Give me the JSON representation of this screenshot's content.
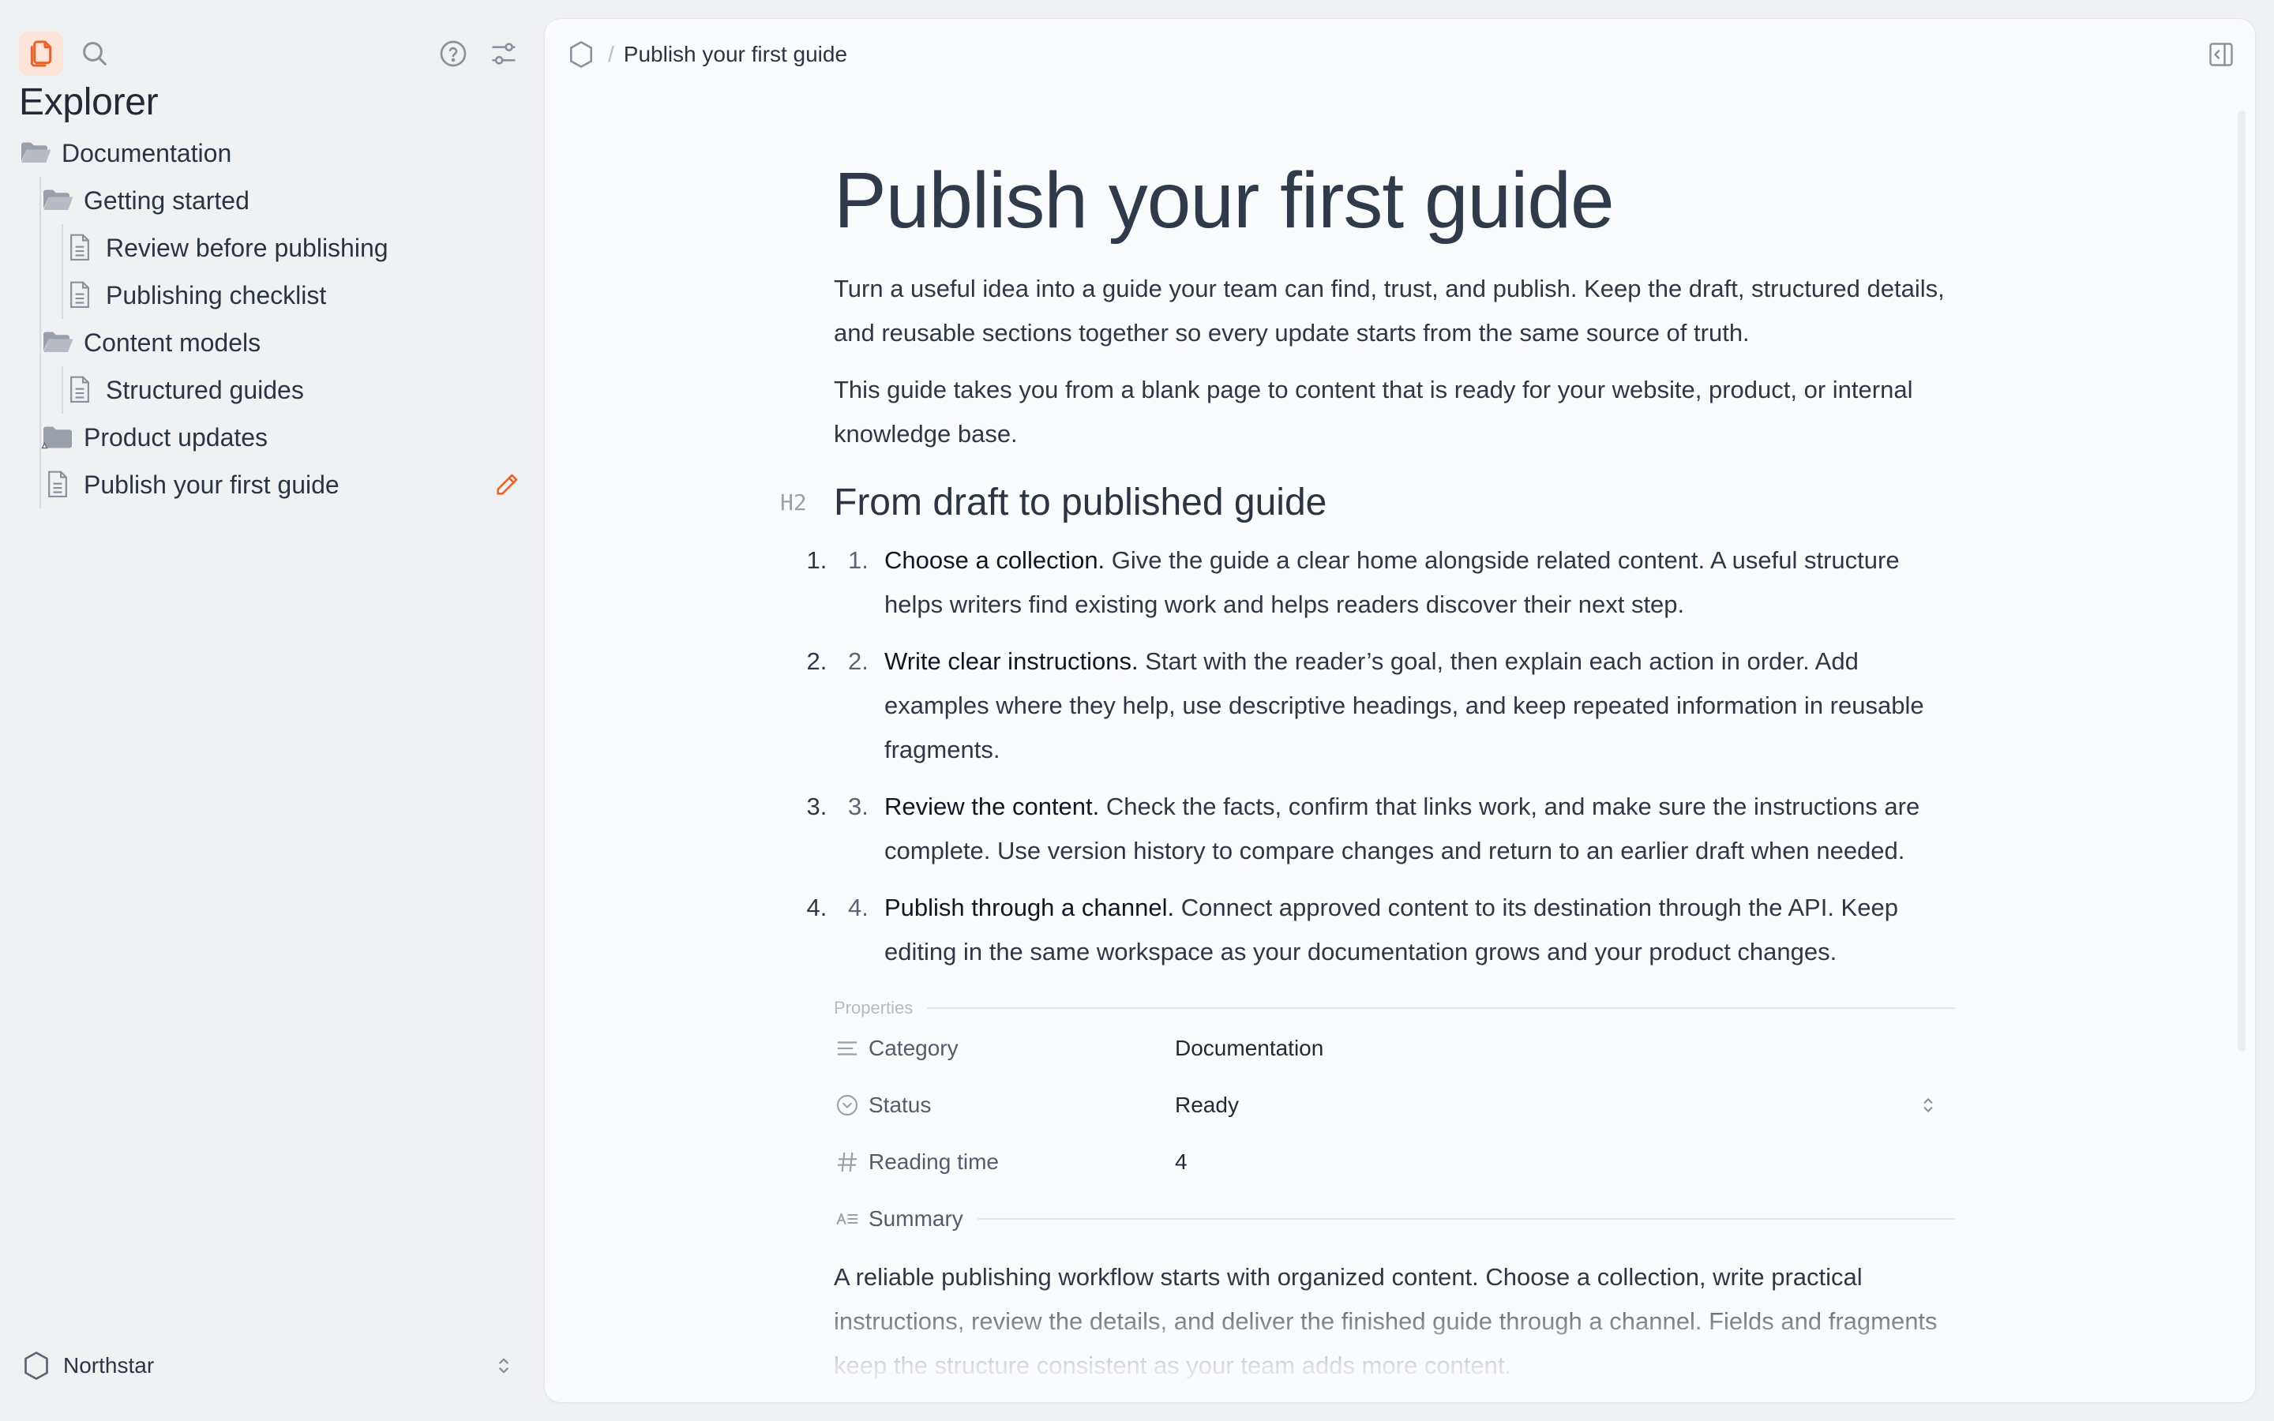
{
  "sidebar": {
    "title": "Explorer",
    "tree": [
      {
        "label": "Documentation",
        "type": "folder-open",
        "depth": 0
      },
      {
        "label": "Getting started",
        "type": "folder-open",
        "depth": 1
      },
      {
        "label": "Review before publishing",
        "type": "file",
        "depth": 2
      },
      {
        "label": "Publishing checklist",
        "type": "file",
        "depth": 2
      },
      {
        "label": "Content models",
        "type": "folder-open",
        "depth": 1
      },
      {
        "label": "Structured guides",
        "type": "file",
        "depth": 2
      },
      {
        "label": "Product updates",
        "type": "folder-closed",
        "depth": 1
      },
      {
        "label": "Publish your first guide",
        "type": "file",
        "depth": 1,
        "active": true
      }
    ],
    "workspace": "Northstar"
  },
  "topbar": {
    "breadcrumb": "Publish your first guide",
    "separator": "/"
  },
  "doc": {
    "title": "Publish your first guide",
    "intro": [
      "Turn a useful idea into a guide your team can find, trust, and publish. Keep the draft, structured details, and reusable sections together so every update starts from the same source of truth.",
      "This guide takes you from a blank page to content that is ready for your website, product, or internal knowledge base."
    ],
    "h2_marker": "H2",
    "h2": "From draft to published guide",
    "steps": [
      {
        "num": "1.",
        "lead": "Choose a collection.",
        "text": " Give the guide a clear home alongside related content. A useful structure helps writers find existing work and helps readers discover their next step."
      },
      {
        "num": "2.",
        "lead": "Write clear instructions.",
        "text": " Start with the reader’s goal, then explain each action in order. Add examples where they help, use descriptive headings, and keep repeated information in reusable fragments."
      },
      {
        "num": "3.",
        "lead": "Review the content.",
        "text": " Check the facts, confirm that links work, and make sure the instructions are complete. Use version history to compare changes and return to an earlier draft when needed."
      },
      {
        "num": "4.",
        "lead": "Publish through a channel.",
        "text": " Connect approved content to its destination through the API. Keep editing in the same workspace as your documentation grows and your product changes."
      }
    ],
    "properties": {
      "label": "Properties",
      "category": {
        "key": "Category",
        "value": "Documentation"
      },
      "status": {
        "key": "Status",
        "value": "Ready"
      },
      "reading_time": {
        "key": "Reading time",
        "value": "4"
      },
      "summary_key": "Summary",
      "summary": "A reliable publishing workflow starts with organized content. Choose a collection, write practical instructions, review the details, and deliver the finished guide through a channel. Fields and fragments keep the structure consistent as your team adds more content."
    }
  },
  "colors": {
    "accent": "#e8622c",
    "sidebar_bg": "#f0f1f3",
    "panel_bg": "#fafbfc",
    "icon_gray": "#8a919c"
  },
  "icons": {
    "explorer": "files-icon",
    "search": "search-icon",
    "help": "help-circle-icon",
    "settings": "sliders-icon",
    "edit": "pencil-icon",
    "workspace": "hexagon-icon",
    "panel_toggle": "sidebar-collapse-icon"
  }
}
